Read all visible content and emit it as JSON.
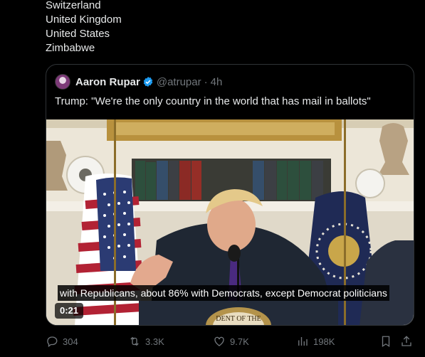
{
  "countries": [
    "Switzerland",
    "United Kingdom",
    "United States",
    "Zimbabwe"
  ],
  "quote": {
    "author_name": "Aaron Rupar",
    "handle": "@atrupar",
    "separator": "·",
    "time": "4h",
    "text": "Trump: \"We're the only country in the world that has mail in ballots\"",
    "video": {
      "caption": "with Republicans, about 86% with Democrats, except Democrat politicians",
      "duration": "0:21",
      "seal_text": "DENT OF THE"
    }
  },
  "actions": {
    "replies": "304",
    "reposts": "3.3K",
    "likes": "9.7K",
    "views": "198K"
  },
  "colors": {
    "background": "#000000",
    "text": "#e7e9ea",
    "muted": "#71767b",
    "verified": "#1d9bf0",
    "border": "#2f3336"
  },
  "icons": [
    "verified-badge-icon",
    "reply-icon",
    "repost-icon",
    "like-icon",
    "views-icon",
    "bookmark-icon",
    "share-icon"
  ]
}
